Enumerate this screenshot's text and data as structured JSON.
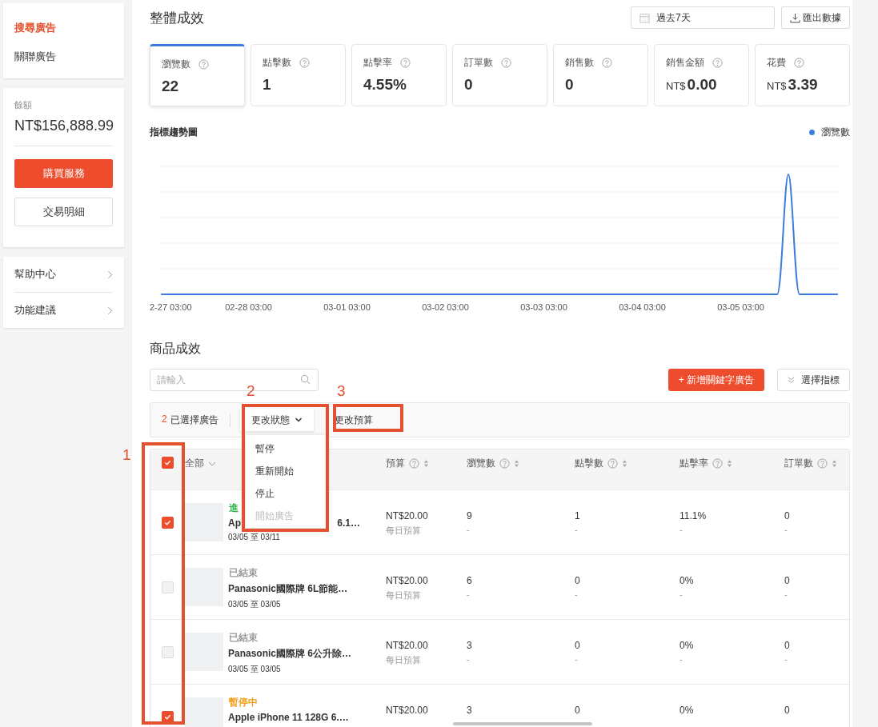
{
  "sidebar": {
    "nav": [
      {
        "label": "搜尋廣告",
        "selected": true
      },
      {
        "label": "關聯廣告",
        "selected": false
      }
    ],
    "balance": {
      "label": "餘額",
      "amount": "NT$156,888.99",
      "buttons": [
        "購買服務",
        "交易明細"
      ]
    },
    "links": [
      "幫助中心",
      "功能建議"
    ]
  },
  "overview": {
    "title": "整體成效",
    "date_range": "過去7天",
    "export_button": "匯出數據",
    "metrics": [
      {
        "label": "瀏覽數",
        "value": "22",
        "selected": true
      },
      {
        "label": "點擊數",
        "value": "1",
        "selected": false
      },
      {
        "label": "點擊率",
        "value": "4.55%",
        "selected": false
      },
      {
        "label": "訂單數",
        "value": "0",
        "selected": false
      },
      {
        "label": "銷售數",
        "value": "0",
        "selected": false
      },
      {
        "label": "銷售金額",
        "prefix": "NT$",
        "value": "0.00",
        "selected": false
      },
      {
        "label": "花費",
        "prefix": "NT$",
        "value": "3.39",
        "selected": false
      }
    ],
    "trend": {
      "title": "指標趨勢圖",
      "legend": "瀏覽數",
      "x_labels": [
        "2-27 03:00",
        "02-28 03:00",
        "03-01 03:00",
        "03-02 03:00",
        "03-03 03:00",
        "03-04 03:00",
        "03-05 03:00"
      ]
    }
  },
  "products": {
    "title": "商品成效",
    "search": {
      "placeholder": "請輸入"
    },
    "add_button": "+ 新增關鍵字廣告",
    "metrics_button": "選擇指標",
    "selection": {
      "count": "2",
      "label": "已選擇廣告"
    },
    "status_button": {
      "label": "更改狀態",
      "expanded": true
    },
    "status_menu": [
      {
        "label": "暫停",
        "disabled": false
      },
      {
        "label": "重新開始",
        "disabled": false
      },
      {
        "label": "停止",
        "disabled": false
      },
      {
        "label": "開始廣告",
        "disabled": true
      }
    ],
    "budget_button": "更改預算",
    "table": {
      "all_selected": true,
      "columns": [
        "全部",
        "預算",
        "瀏覽數",
        "點擊數",
        "點擊率",
        "訂單數"
      ],
      "rows": [
        {
          "selected": true,
          "status": "進",
          "color": "#2fb34a",
          "name_parts": [
            "Ap",
            "6.1…"
          ],
          "dates": "03/05 至 03/11",
          "budget": "NT$20.00",
          "budget_note": "每日預算",
          "views": "9",
          "clicks": "1",
          "ctr": "11.1%",
          "orders": "0",
          "notes": [
            "-",
            "-",
            "-",
            "-"
          ]
        },
        {
          "selected": false,
          "status": "已結束",
          "color": "#999999",
          "name_parts": [
            "Panasonic國際牌 6L節能…"
          ],
          "dates": "03/05 至 03/05",
          "budget": "NT$20.00",
          "budget_note": "每日預算",
          "views": "6",
          "clicks": "0",
          "ctr": "0%",
          "orders": "0",
          "notes": [
            "-",
            "-",
            "-",
            "-"
          ]
        },
        {
          "selected": false,
          "status": "已結束",
          "color": "#999999",
          "name_parts": [
            "Panasonic國際牌 6公升除…"
          ],
          "dates": "03/05 至 03/05",
          "budget": "NT$20.00",
          "budget_note": "每日預算",
          "views": "3",
          "clicks": "0",
          "ctr": "0%",
          "orders": "0",
          "notes": [
            "-",
            "-",
            "-",
            "-"
          ]
        },
        {
          "selected": true,
          "status": "暫停中",
          "color": "#f0a020",
          "name_parts": [
            "Apple iPhone 11 128G 6.…"
          ],
          "budget": "NT$20.00",
          "views": "3",
          "clicks": "0",
          "ctr": "0%",
          "orders": "0"
        }
      ]
    }
  },
  "annotations": [
    {
      "label": "1"
    },
    {
      "label": "2"
    },
    {
      "label": "3"
    }
  ]
}
